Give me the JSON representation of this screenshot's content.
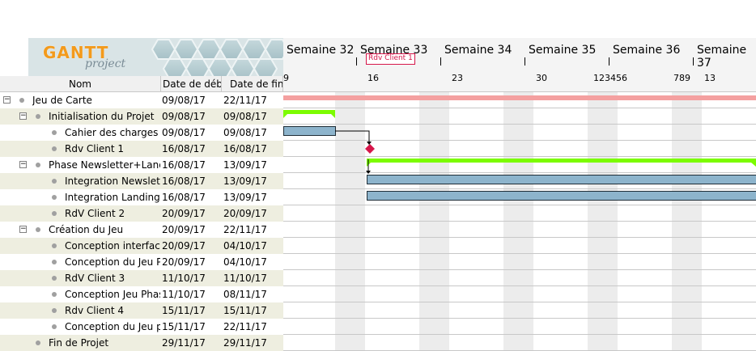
{
  "logo": {
    "brand": "GANTT",
    "sub": "project"
  },
  "table": {
    "columns": {
      "name": "Nom",
      "start": "Date de déb...",
      "end": "Date de fin"
    },
    "rows": [
      {
        "name": "Jeu de Carte",
        "start": "09/08/17",
        "end": "22/11/17"
      },
      {
        "name": "Initialisation du Projet",
        "start": "09/08/17",
        "end": "09/08/17"
      },
      {
        "name": "Cahier des charges",
        "start": "09/08/17",
        "end": "09/08/17"
      },
      {
        "name": "Rdv Client 1",
        "start": "16/08/17",
        "end": "16/08/17"
      },
      {
        "name": "Phase Newsletter+Landi...",
        "start": "16/08/17",
        "end": "13/09/17"
      },
      {
        "name": "Integration Newsletter",
        "start": "16/08/17",
        "end": "13/09/17"
      },
      {
        "name": "Integration Landing...",
        "start": "16/08/17",
        "end": "13/09/17"
      },
      {
        "name": "RdV Client 2",
        "start": "20/09/17",
        "end": "20/09/17"
      },
      {
        "name": "Création du Jeu",
        "start": "20/09/17",
        "end": "22/11/17"
      },
      {
        "name": "Conception interfac...",
        "start": "20/09/17",
        "end": "04/10/17"
      },
      {
        "name": "Conception du Jeu P...",
        "start": "20/09/17",
        "end": "04/10/17"
      },
      {
        "name": "RdV Client 3",
        "start": "11/10/17",
        "end": "11/10/17"
      },
      {
        "name": "Conception Jeu Phas...",
        "start": "11/10/17",
        "end": "08/11/17"
      },
      {
        "name": "Rdv Client 4",
        "start": "15/11/17",
        "end": "15/11/17"
      },
      {
        "name": "Conception du Jeu p...",
        "start": "15/11/17",
        "end": "22/11/17"
      },
      {
        "name": "Fin de Projet",
        "start": "29/11/17",
        "end": "29/11/17"
      }
    ]
  },
  "timeline": {
    "weeks": [
      "Semaine 32",
      "Semaine 33",
      "Semaine 34",
      "Semaine 35",
      "Semaine 36",
      "Semaine 37"
    ],
    "days": [
      "9",
      "16",
      "23",
      "30",
      "123456",
      "789",
      "13"
    ],
    "milestone_label": "Rdv Client 1"
  },
  "colors": {
    "task_bar": "#8db4cc",
    "summary_bar": "#7cfc00",
    "project_bar": "#f4a0a0",
    "milestone": "#d6164a",
    "row_alt": "#eeeee0"
  }
}
